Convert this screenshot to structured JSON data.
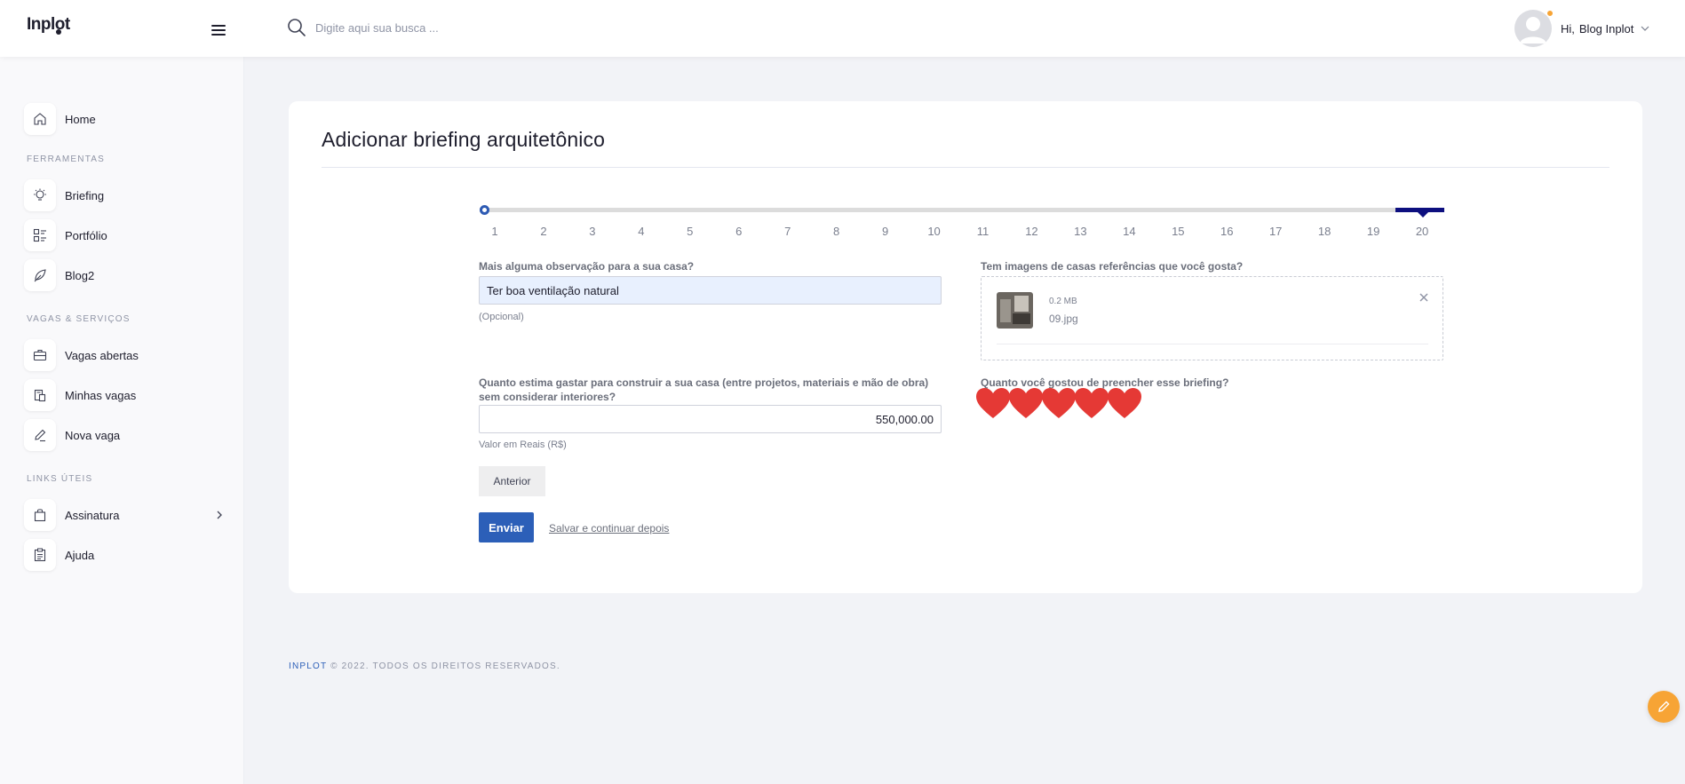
{
  "topbar": {
    "logo": "Inplot",
    "search_placeholder": "Digite aqui sua busca ...",
    "greeting": "Hi,",
    "user_name": "Blog Inplot"
  },
  "sidebar": {
    "home": "Home",
    "section_tools": "FERRAMENTAS",
    "briefing": "Briefing",
    "portfolio": "Portfólio",
    "blog": "Blog2",
    "section_jobs": "VAGAS & SERVIÇOS",
    "open_jobs": "Vagas abertas",
    "my_jobs": "Minhas vagas",
    "new_job": "Nova vaga",
    "section_links": "LINKS ÚTEIS",
    "subscription": "Assinatura",
    "help": "Ajuda"
  },
  "card": {
    "title": "Adicionar briefing arquitetônico",
    "steps": [
      "1",
      "2",
      "3",
      "4",
      "5",
      "6",
      "7",
      "8",
      "9",
      "10",
      "11",
      "12",
      "13",
      "14",
      "15",
      "16",
      "17",
      "18",
      "19",
      "20"
    ],
    "current_step": 20,
    "obs_label": "Mais alguma observação para a sua casa?",
    "obs_value": "Ter boa ventilação natural",
    "obs_hint": "(Opcional)",
    "images_label": "Tem imagens de casas referências que você gosta?",
    "file_size": "0.2 MB",
    "file_name": "09.jpg",
    "budget_label": "Quanto estima gastar para construir a sua casa (entre projetos, materiais e mão de obra) sem considerar interiores?",
    "budget_value": "550,000.00",
    "budget_hint": "Valor em Reais (R$)",
    "rating_label": "Quanto você gostou de preencher esse briefing?",
    "rating": {
      "value": 5,
      "max": 5
    },
    "heart_color": "#e53935",
    "prev_button": "Anterior",
    "send_button": "Enviar",
    "save_link": "Salvar e continuar depois"
  },
  "footer": {
    "brand": "INPLOT",
    "rest": " © 2022. TODOS OS DIREITOS RESERVADOS."
  },
  "colors": {
    "primary": "#2c5fb8",
    "step_active": "#0d0f7f",
    "accent": "#f7a435"
  }
}
